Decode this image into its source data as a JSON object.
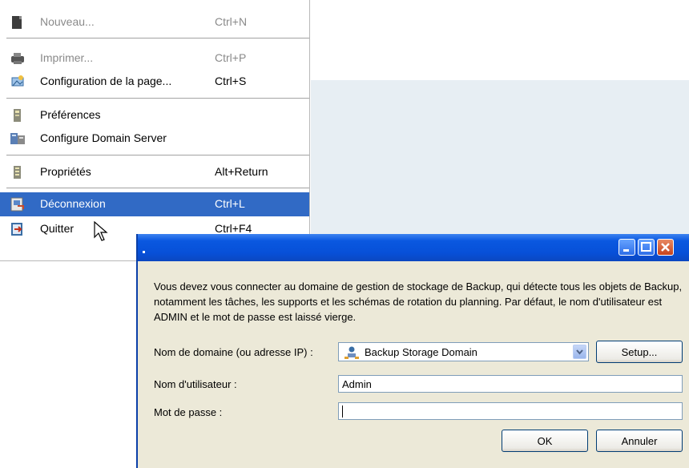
{
  "menu": {
    "items": [
      {
        "label": "Nouveau...",
        "shortcut": "Ctrl+N",
        "icon": "new-document-icon",
        "disabled": true
      },
      {
        "label": "Imprimer...",
        "shortcut": "Ctrl+P",
        "icon": "printer-icon",
        "disabled": true
      },
      {
        "label": "Configuration de la page...",
        "shortcut": "Ctrl+S",
        "icon": "page-setup-icon",
        "disabled": false
      },
      {
        "label": "Préférences",
        "shortcut": "",
        "icon": "preferences-icon",
        "disabled": false
      },
      {
        "label": "Configure Domain Server",
        "shortcut": "",
        "icon": "domain-server-icon",
        "disabled": false
      },
      {
        "label": "Propriétés",
        "shortcut": "Alt+Return",
        "icon": "properties-icon",
        "disabled": false
      },
      {
        "label": "Déconnexion",
        "shortcut": "Ctrl+L",
        "icon": "logout-icon",
        "disabled": false,
        "selected": true
      },
      {
        "label": "Quitter",
        "shortcut": "Ctrl+F4",
        "icon": "exit-icon",
        "disabled": false
      }
    ]
  },
  "dialog": {
    "message": "Vous devez vous connecter au domaine de gestion de stockage de Backup, qui détecte tous les objets de Backup, notamment les tâches, les supports et les schémas de rotation du planning. Par défaut, le nom d'utilisateur est ADMIN et le mot de passe est laissé vierge.",
    "domain_label": "Nom de domaine (ou adresse IP) :",
    "domain_value": "Backup Storage Domain",
    "setup_button": "Setup...",
    "user_label": "Nom d'utilisateur :",
    "user_value": "Admin",
    "password_label": "Mot de passe :",
    "password_value": "",
    "ok_button": "OK",
    "cancel_button": "Annuler"
  },
  "colors": {
    "selection": "#316ac5",
    "titlebar": "#0750d8",
    "dialog_bg": "#ece9d8"
  }
}
